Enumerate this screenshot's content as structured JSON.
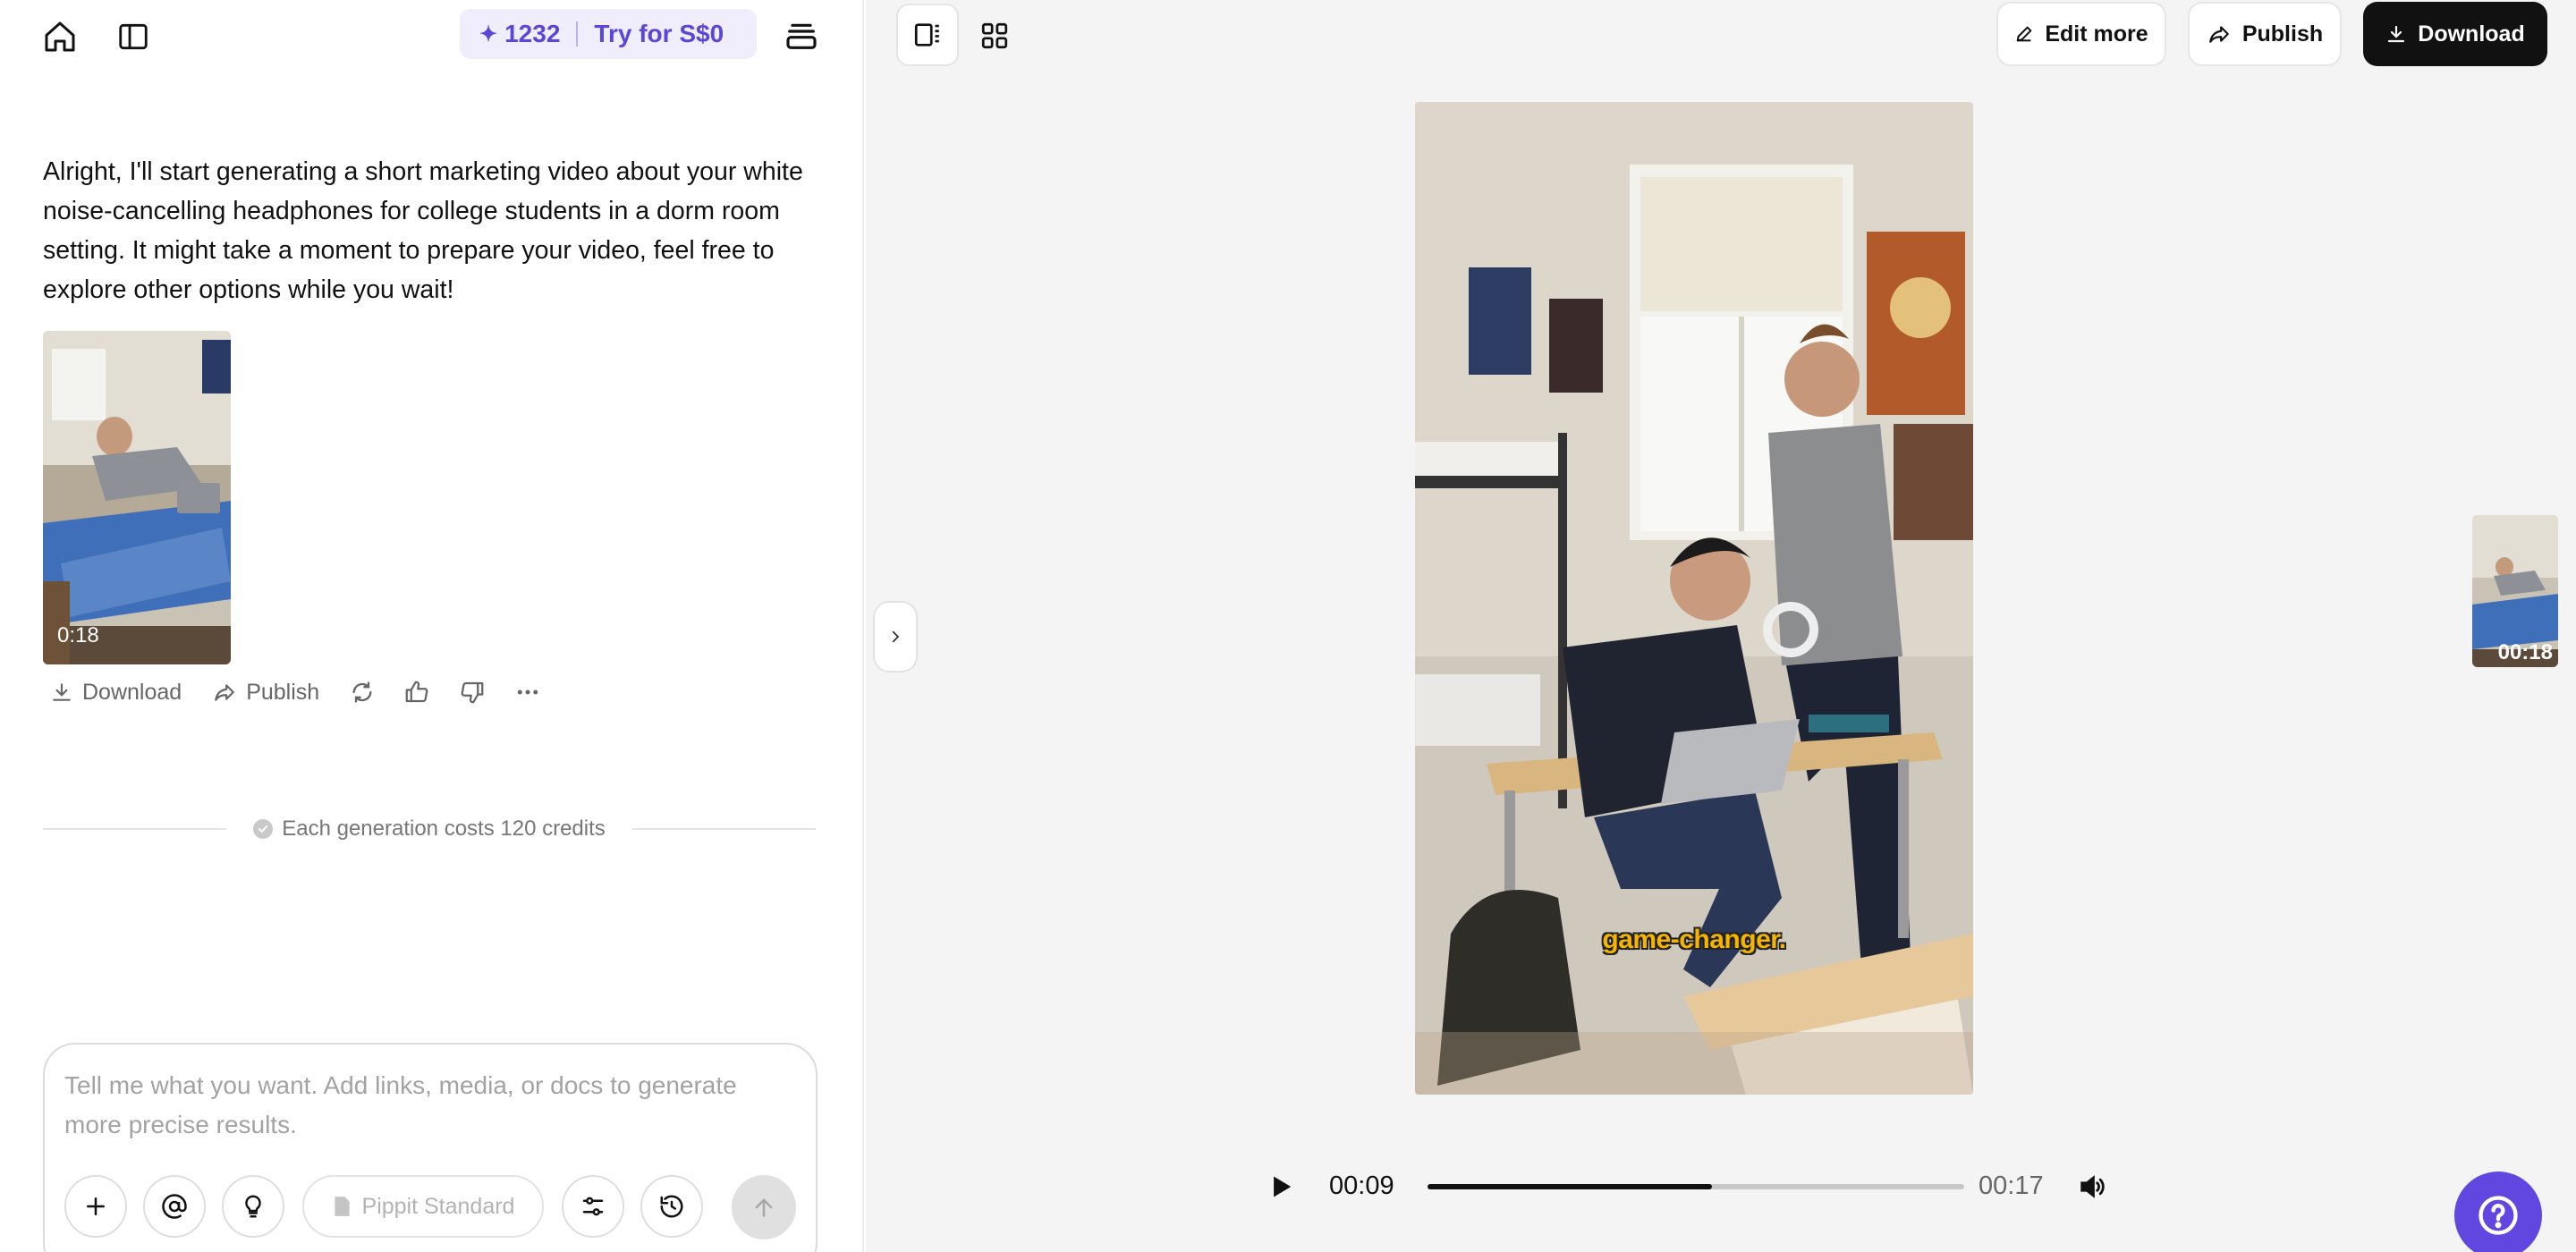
{
  "header": {
    "credits": "1232",
    "trial_label": "Try for S$0"
  },
  "chat": {
    "message": "Alright, I'll start generating a short marketing video about your white noise-cancelling headphones for college students in a dorm room setting. It might take a moment to prepare your video, feel free to explore other options while you wait!",
    "video_duration": "0:18",
    "actions": {
      "download_label": "Download",
      "publish_label": "Publish"
    },
    "cost_note": "Each generation costs 120 credits"
  },
  "composer": {
    "placeholder": "Tell me what you want. Add links, media, or docs to generate more precise results.",
    "model_label": "Pippit Standard"
  },
  "preview": {
    "edit_more_label": "Edit more",
    "publish_label": "Publish",
    "download_label": "Download",
    "caption": "game-changer.",
    "side_thumb_duration": "00:18",
    "player": {
      "current_time": "00:09",
      "total_time": "00:17",
      "progress": 0.53
    }
  },
  "colors": {
    "accent": "#6147e0",
    "caption": "#f4b400"
  }
}
